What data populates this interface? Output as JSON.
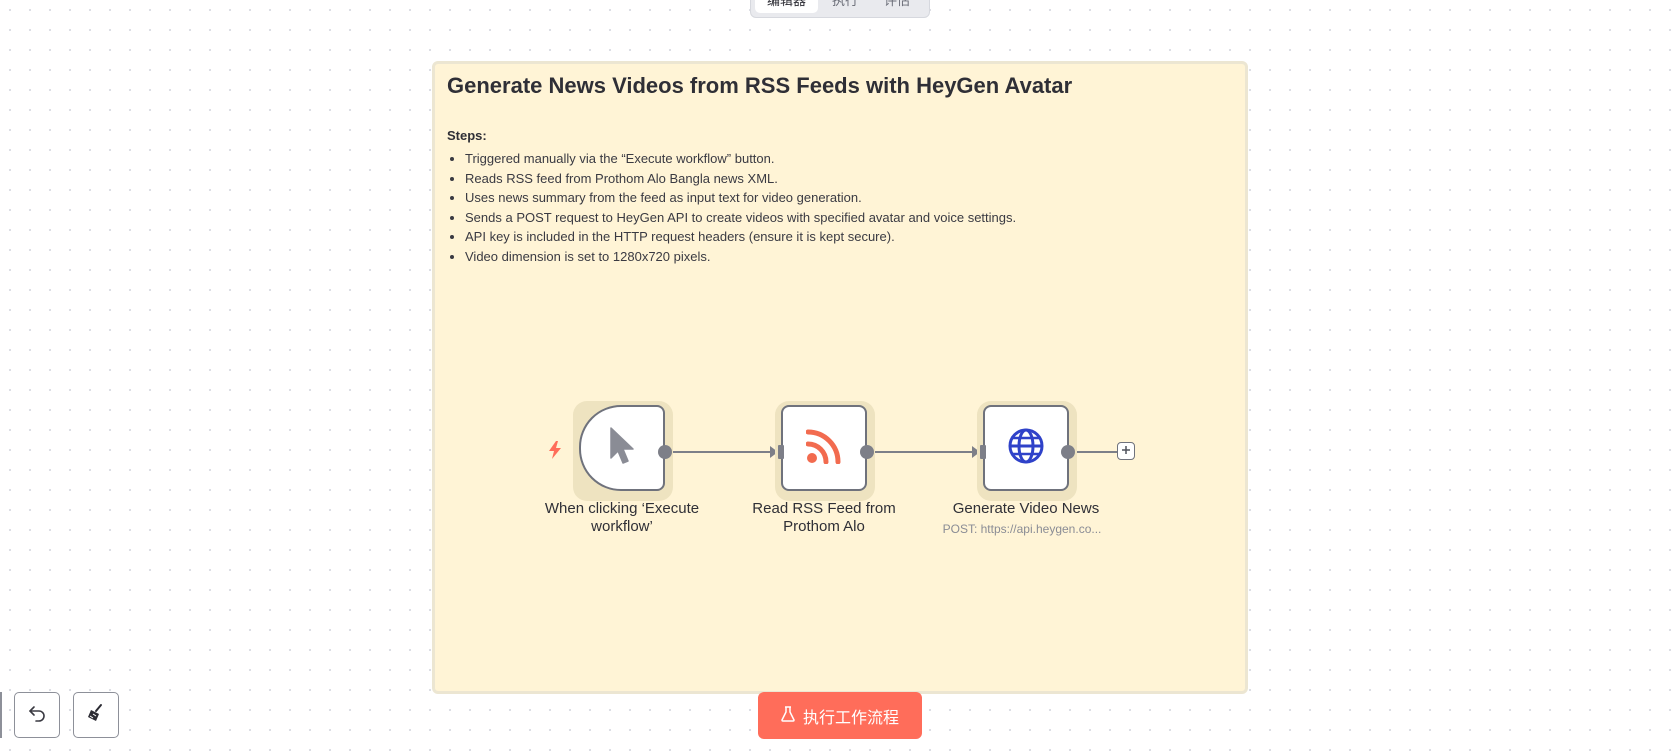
{
  "top_tabs": [
    {
      "label": "编辑器",
      "active": true
    },
    {
      "label": "执行",
      "active": false
    },
    {
      "label": "评估",
      "active": false
    }
  ],
  "sticky": {
    "title": "Generate News Videos from RSS Feeds with HeyGen Avatar",
    "steps_label": "Steps:",
    "steps": [
      "Triggered manually via the “Execute workflow” button.",
      "Reads RSS feed from Prothom Alo Bangla news XML.",
      "Uses news summary from the feed as input text for video generation.",
      "Sends a POST request to HeyGen API to create videos with specified avatar and voice settings.",
      "API key is included in the HTTP request headers (ensure it is kept secure).",
      "Video dimension is set to 1280x720 pixels."
    ],
    "background_color": "#fff4d6"
  },
  "nodes": [
    {
      "label": "When clicking ‘Execute workflow’",
      "icon": "cursor-icon"
    },
    {
      "label": "Read RSS Feed from Prothom Alo",
      "icon": "rss-icon",
      "icon_color": "#f26b4f"
    },
    {
      "label": "Generate Video News",
      "subtitle": "POST: https://api.heygen.co...",
      "icon": "globe-icon",
      "icon_color": "#2f42c9"
    }
  ],
  "execute_button": {
    "label": "执行工作流程",
    "icon": "flask-icon",
    "color": "#ff6d5a"
  },
  "controls": [
    {
      "icon": "undo-icon"
    },
    {
      "icon": "broom-icon"
    }
  ],
  "trigger_indicator": {
    "icon": "lightning-icon",
    "color": "#ff6d5a"
  }
}
